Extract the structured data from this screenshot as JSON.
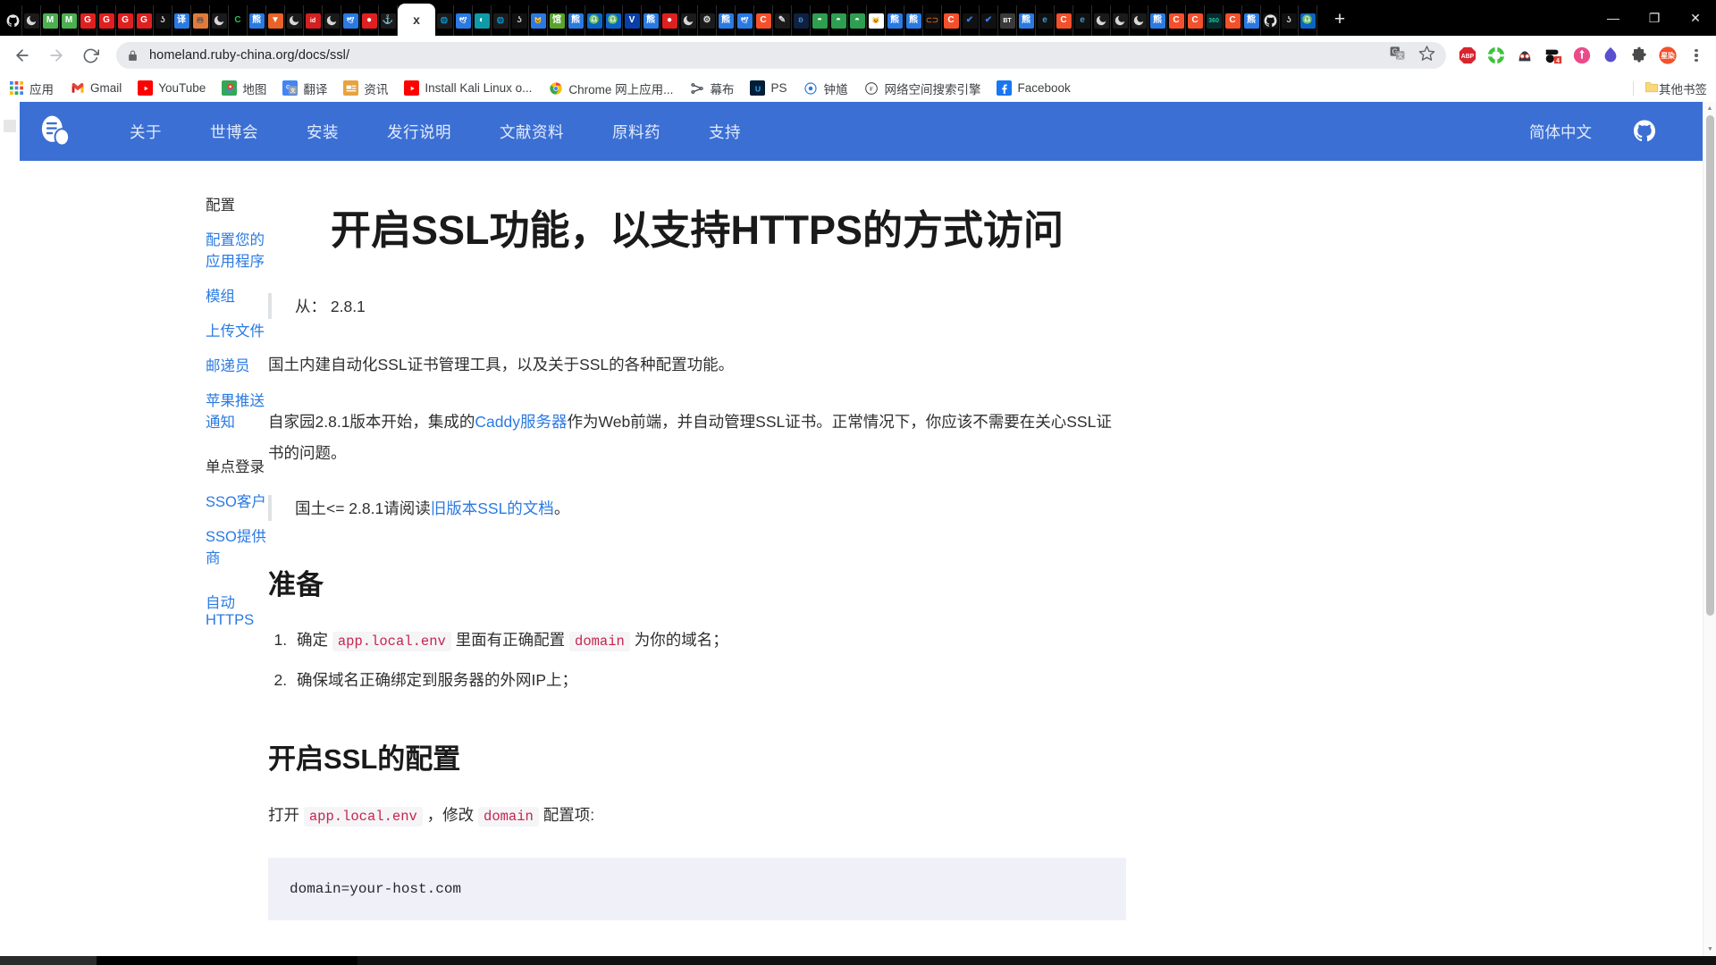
{
  "window": {
    "minimize": "—",
    "maximize": "❐",
    "close": "✕",
    "new_tab": "+"
  },
  "tabs": {
    "active_label": "x",
    "items": [
      {
        "name": "github-tab",
        "glyph": "",
        "bg": "#000000",
        "fg": "#ffffff",
        "kind": "github"
      },
      {
        "name": "dark-tab",
        "glyph": "",
        "bg": "#1b1b1b",
        "fg": "#ffffff",
        "kind": "moon"
      },
      {
        "name": "m-green-tab-1",
        "glyph": "M",
        "bg": "#4caf50",
        "fg": "#ffffff"
      },
      {
        "name": "m-green-tab-2",
        "glyph": "M",
        "bg": "#4caf50",
        "fg": "#ffffff"
      },
      {
        "name": "g-red-tab-1",
        "glyph": "G",
        "bg": "#e02020",
        "fg": "#ffffff"
      },
      {
        "name": "g-red-tab-2",
        "glyph": "G",
        "bg": "#e02020",
        "fg": "#ffffff"
      },
      {
        "name": "g-red-tab-3",
        "glyph": "G",
        "bg": "#e02020",
        "fg": "#ffffff"
      },
      {
        "name": "g-red-tab-4",
        "glyph": "G",
        "bg": "#e02020",
        "fg": "#ffffff"
      },
      {
        "name": "script-tab",
        "glyph": "ʖ",
        "bg": "#111111",
        "fg": "#c8c8c8"
      },
      {
        "name": "translate-tab",
        "glyph": "译",
        "bg": "#2a7ae2",
        "fg": "#ffffff"
      },
      {
        "name": "bear-tab",
        "glyph": "🐻",
        "bg": "#e07b39",
        "fg": "#ffffff"
      },
      {
        "name": "moon2-tab",
        "glyph": "",
        "bg": "#1b1b1b",
        "fg": "#dddddd",
        "kind": "moon"
      },
      {
        "name": "c-green-tab",
        "glyph": "C",
        "bg": "#000000",
        "fg": "#22c55e"
      },
      {
        "name": "baidu-tab-1",
        "glyph": "熊",
        "bg": "#2a7ae2",
        "fg": "#ffffff"
      },
      {
        "name": "orange-flag-tab",
        "glyph": "▼",
        "bg": "#e8622a",
        "fg": "#ffffff"
      },
      {
        "name": "moon3-tab",
        "glyph": "",
        "bg": "#1b1b1b",
        "fg": "#dddddd",
        "kind": "moon"
      },
      {
        "name": "id-red-tab",
        "glyph": "id",
        "bg": "#d32020",
        "fg": "#ffffff"
      },
      {
        "name": "moon4-tab",
        "glyph": "",
        "bg": "#1b1b1b",
        "fg": "#dddddd",
        "kind": "moon"
      },
      {
        "name": "blue-bird-tab",
        "glyph": "🕊",
        "bg": "#2a7ae2",
        "fg": "#ffffff"
      },
      {
        "name": "red-bean-tab",
        "glyph": "●",
        "bg": "#e02020",
        "fg": "#ffffff"
      },
      {
        "name": "anchor-tab",
        "glyph": "⚓",
        "bg": "#1b1b1b",
        "fg": "#b9c4ce"
      },
      {
        "name": "active-tab",
        "glyph": "x",
        "bg": "#ffffff",
        "fg": "#333333",
        "active": true
      },
      {
        "name": "globe-tab-1",
        "glyph": "🌐",
        "bg": "#1b1b1b",
        "fg": "#b9c4ce"
      },
      {
        "name": "blue-bird-tab-2",
        "glyph": "🕊",
        "bg": "#2a7ae2",
        "fg": "#ffffff"
      },
      {
        "name": "teal-circle-tab",
        "glyph": "◐",
        "bg": "#0f9aa8",
        "fg": "#ffffff"
      },
      {
        "name": "globe-tab-2",
        "glyph": "🌐",
        "bg": "#1b1b1b",
        "fg": "#b9c4ce"
      },
      {
        "name": "script-tab-2",
        "glyph": "ʖ",
        "bg": "#111111",
        "fg": "#c8c8c8"
      },
      {
        "name": "doraemon-tab",
        "glyph": "😺",
        "bg": "#2a7ae2",
        "fg": "#ffffff"
      },
      {
        "name": "guan-green-tab",
        "glyph": "馆",
        "bg": "#5aa32e",
        "fg": "#ffffff"
      },
      {
        "name": "baidu-tab-2",
        "glyph": "熊",
        "bg": "#2a7ae2",
        "fg": "#ffffff"
      },
      {
        "name": "libra-tab-1",
        "glyph": "♎",
        "bg": "#0b64c8",
        "fg": "#ffffff"
      },
      {
        "name": "libra-tab-2",
        "glyph": "♎",
        "bg": "#0b64c8",
        "fg": "#ffffff"
      },
      {
        "name": "v-blue-tab",
        "glyph": "V",
        "bg": "#0b3fa8",
        "fg": "#ffffff"
      },
      {
        "name": "baidu-tab-3",
        "glyph": "熊",
        "bg": "#2a7ae2",
        "fg": "#ffffff"
      },
      {
        "name": "red-bean-tab-2",
        "glyph": "●",
        "bg": "#e02020",
        "fg": "#ffffff"
      },
      {
        "name": "moon5-tab",
        "glyph": "",
        "bg": "#1b1b1b",
        "fg": "#dddddd",
        "kind": "moon"
      },
      {
        "name": "gear-tab",
        "glyph": "⚙",
        "bg": "#1b1b1b",
        "fg": "#e0e0e0"
      },
      {
        "name": "baidu-tab-4",
        "glyph": "熊",
        "bg": "#2a7ae2",
        "fg": "#ffffff"
      },
      {
        "name": "blue-bird-tab-3",
        "glyph": "🕊",
        "bg": "#2a7ae2",
        "fg": "#ffffff"
      },
      {
        "name": "c-orange-tab-1",
        "glyph": "C",
        "bg": "#f4502b",
        "fg": "#ffffff"
      },
      {
        "name": "pen-tab",
        "glyph": "✎",
        "bg": "#1b1b1b",
        "fg": "#dcdcdc"
      },
      {
        "name": "dna-tab",
        "glyph": "ʚ",
        "bg": "#0f2040",
        "fg": "#4a8fd4"
      },
      {
        "name": "green-dome-tab-1",
        "glyph": "◓",
        "bg": "#2e9e4f",
        "fg": "#ffffff"
      },
      {
        "name": "green-dome-tab-2",
        "glyph": "◓",
        "bg": "#2e9e4f",
        "fg": "#ffffff"
      },
      {
        "name": "green-dome-tab-3",
        "glyph": "◓",
        "bg": "#2e9e4f",
        "fg": "#ffffff"
      },
      {
        "name": "doraemon-tab-2",
        "glyph": "😺",
        "bg": "#ffffff",
        "fg": "#2a7ae2"
      },
      {
        "name": "baidu-tab-5",
        "glyph": "熊",
        "bg": "#2a7ae2",
        "fg": "#ffffff"
      },
      {
        "name": "baidu-tab-6",
        "glyph": "熊",
        "bg": "#2a7ae2",
        "fg": "#ffffff"
      },
      {
        "name": "orange-bracket-tab",
        "glyph": "⊂⊃",
        "bg": "#111111",
        "fg": "#f07020"
      },
      {
        "name": "c-orange-tab-2",
        "glyph": "C",
        "bg": "#f4502b",
        "fg": "#ffffff"
      },
      {
        "name": "v-check-tab-1",
        "glyph": "✔",
        "bg": "#111111",
        "fg": "#2f80ed"
      },
      {
        "name": "v-check-tab-2",
        "glyph": "✔",
        "bg": "#111111",
        "fg": "#2f80ed"
      },
      {
        "name": "bt-tab",
        "glyph": "BT",
        "bg": "#3a3a3a",
        "fg": "#ffffff"
      },
      {
        "name": "baidu-tab-7",
        "glyph": "熊",
        "bg": "#2a7ae2",
        "fg": "#ffffff"
      },
      {
        "name": "edge-tab-1",
        "glyph": "e",
        "bg": "#111111",
        "fg": "#2f9fe0"
      },
      {
        "name": "c-orange-tab-3",
        "glyph": "C",
        "bg": "#f4502b",
        "fg": "#ffffff"
      },
      {
        "name": "edge-tab-2",
        "glyph": "e",
        "bg": "#111111",
        "fg": "#2f9fe0"
      },
      {
        "name": "moon6-tab",
        "glyph": "",
        "bg": "#1b1b1b",
        "fg": "#dddddd",
        "kind": "moon"
      },
      {
        "name": "moon7-tab",
        "glyph": "",
        "bg": "#1b1b1b",
        "fg": "#dddddd",
        "kind": "moon"
      },
      {
        "name": "moon8-tab",
        "glyph": "",
        "bg": "#1b1b1b",
        "fg": "#dddddd",
        "kind": "moon"
      },
      {
        "name": "baidu-tab-8",
        "glyph": "熊",
        "bg": "#2a7ae2",
        "fg": "#ffffff"
      },
      {
        "name": "c-orange-tab-4",
        "glyph": "C",
        "bg": "#f4502b",
        "fg": "#ffffff"
      },
      {
        "name": "c-orange-tab-5",
        "glyph": "C",
        "bg": "#f4502b",
        "fg": "#ffffff"
      },
      {
        "name": "safe360-tab",
        "glyph": "360",
        "bg": "#0b2b2b",
        "fg": "#1fc4a8"
      },
      {
        "name": "c-orange-tab-6",
        "glyph": "C",
        "bg": "#f4502b",
        "fg": "#ffffff"
      },
      {
        "name": "baidu-tab-9",
        "glyph": "熊",
        "bg": "#2a7ae2",
        "fg": "#ffffff"
      },
      {
        "name": "github-tab-2",
        "glyph": "",
        "bg": "#111111",
        "fg": "#dddddd",
        "kind": "github"
      },
      {
        "name": "script-tab-3",
        "glyph": "ʖ",
        "bg": "#111111",
        "fg": "#c8c8c8"
      },
      {
        "name": "libra-tab-3",
        "glyph": "♎",
        "bg": "#0b64c8",
        "fg": "#ffffff"
      }
    ]
  },
  "toolbar": {
    "back": "←",
    "forward": "→",
    "reload": "⟳",
    "url": "homeland.ruby-china.org/docs/ssl/",
    "lock_icon": "lock-icon",
    "translate_icon": "translate-icon",
    "bookmark_star": "☆",
    "extensions": [
      {
        "name": "adblock-plus-extension",
        "label": "ABP",
        "bg": "#d9232e",
        "fg": "#ffffff"
      },
      {
        "name": "tampermonkey-extension",
        "label": "🧩",
        "bg": "#3ec13e",
        "fg": "#ffffff"
      },
      {
        "name": "dark-reader-extension",
        "label": "👓",
        "bg": "#2b3a4a",
        "fg": "#ffffff"
      },
      {
        "name": "downloads-extension",
        "label": "4",
        "bg": "#2b2b2b",
        "fg": "#ffffff",
        "badge": "4",
        "badge_color": "#e03b2f"
      },
      {
        "name": "pink-tool-extension",
        "label": "T",
        "bg": "#ec4b89",
        "fg": "#ffffff"
      },
      {
        "name": "simplenote-extension",
        "label": "❀",
        "bg": "#5a4fcf",
        "fg": "#ffffff"
      },
      {
        "name": "puzzle-extensions-menu",
        "label": "🧩",
        "bg": "#ffffff",
        "fg": "#5f6368"
      },
      {
        "name": "xingran-extension",
        "label": "星染",
        "bg": "#f4502b",
        "fg": "#ffffff"
      }
    ],
    "menu": "chrome-menu-icon"
  },
  "bookmarks": {
    "items": [
      {
        "name": "bookmark-apps",
        "label": "应用",
        "icon": "apps-grid-icon",
        "bg": "transparent",
        "fg": "#4285f4",
        "glyph": "⠿"
      },
      {
        "name": "bookmark-gmail",
        "label": "Gmail",
        "icon": "gmail-icon",
        "bg": "transparent",
        "fg": "#ea4335",
        "glyph": "G"
      },
      {
        "name": "bookmark-youtube",
        "label": "YouTube",
        "icon": "youtube-icon",
        "bg": "#ff0000",
        "fg": "#ffffff",
        "glyph": "▶"
      },
      {
        "name": "bookmark-maps",
        "label": "地图",
        "icon": "maps-pin-icon",
        "bg": "#34a853",
        "fg": "#ffffff",
        "glyph": "📍"
      },
      {
        "name": "bookmark-translate",
        "label": "翻译",
        "icon": "translate-icon",
        "bg": "#4285f4",
        "fg": "#ffffff",
        "glyph": "文"
      },
      {
        "name": "bookmark-news",
        "label": "资讯",
        "icon": "news-icon",
        "bg": "#e8a33d",
        "fg": "#ffffff",
        "glyph": "📰"
      },
      {
        "name": "bookmark-install-kali",
        "label": "Install Kali Linux o...",
        "icon": "youtube-icon",
        "bg": "#ff0000",
        "fg": "#ffffff",
        "glyph": "▶"
      },
      {
        "name": "bookmark-chrome-webstore",
        "label": "Chrome 网上应用...",
        "icon": "chrome-icon",
        "bg": "transparent",
        "fg": "#4285f4",
        "glyph": "◉"
      },
      {
        "name": "bookmark-mubu",
        "label": "幕布",
        "icon": "mubu-icon",
        "bg": "transparent",
        "fg": "#2f3640",
        "glyph": "⋈"
      },
      {
        "name": "bookmark-ps",
        "label": "PS",
        "icon": "photoshop-icon",
        "bg": "#001e36",
        "fg": "#31a8ff",
        "glyph": "U"
      },
      {
        "name": "bookmark-zhongkui",
        "label": "钟馗",
        "icon": "zhongkui-icon",
        "bg": "transparent",
        "fg": "#2a7ae2",
        "glyph": "◎"
      },
      {
        "name": "bookmark-cyberspace-search",
        "label": "网络空间搜索引擎",
        "icon": "fofa-icon",
        "bg": "transparent",
        "fg": "#444444",
        "glyph": "Ⓕ"
      },
      {
        "name": "bookmark-facebook",
        "label": "Facebook",
        "icon": "facebook-icon",
        "bg": "#1877f2",
        "fg": "#ffffff",
        "glyph": "f"
      }
    ],
    "other_bookmarks": {
      "label": "其他书签",
      "icon": "folder-icon"
    }
  },
  "site": {
    "brand_icon": "homeland-logo-icon",
    "nav": [
      {
        "name": "nav-about",
        "label": "关于"
      },
      {
        "name": "nav-expo",
        "label": "世博会"
      },
      {
        "name": "nav-install",
        "label": "安装"
      },
      {
        "name": "nav-release-notes",
        "label": "发行说明"
      },
      {
        "name": "nav-documentation",
        "label": "文献资料"
      },
      {
        "name": "nav-api",
        "label": "原料药"
      },
      {
        "name": "nav-support",
        "label": "支持"
      }
    ],
    "language": "简体中文",
    "github_icon": "github-icon",
    "nav_bg": "#3b6fd4"
  },
  "sidebar": {
    "groups": [
      {
        "name": "sidebar-group-configuration",
        "title": "配置",
        "links": [
          {
            "name": "sidebar-link-configure-your-app",
            "label": "配置您的应用程序"
          },
          {
            "name": "sidebar-link-modules",
            "label": "模组"
          },
          {
            "name": "sidebar-link-upload-files",
            "label": "上传文件"
          },
          {
            "name": "sidebar-link-mailman",
            "label": "邮递员"
          },
          {
            "name": "sidebar-link-apple-push",
            "label": "苹果推送通知"
          }
        ]
      },
      {
        "name": "sidebar-group-sso",
        "title": "单点登录",
        "links": [
          {
            "name": "sidebar-link-sso-client",
            "label": "SSO客户"
          },
          {
            "name": "sidebar-link-sso-provider",
            "label": "SSO提供商"
          }
        ]
      },
      {
        "name": "sidebar-group-auto-https",
        "title": "",
        "links": [
          {
            "name": "sidebar-link-auto-https",
            "label": "自动HTTPS"
          }
        ]
      }
    ]
  },
  "article": {
    "title": "开启SSL功能，以支持HTTPS的方式访问",
    "note_version": "从： 2.8.1",
    "paragraph_1": "国土内建自动化SSL证书管理工具，以及关于SSL的各种配置功能。",
    "paragraph_2_a": "自家园2.8.1版本开始，集成的",
    "paragraph_2_link": "Caddy服务器",
    "paragraph_2_b": "作为Web前端，并自动管理SSL证书。正常情况下，你应该不需要在关心SSL证书的问题。",
    "note_2_a": "国土<= 2.8.1请阅读",
    "note_2_link": "旧版本SSL的文档",
    "note_2_b": "。",
    "section_prepare": "准备",
    "steps": [
      {
        "name": "step-item-1",
        "text_a": "确定 ",
        "code_1": "app.local.env",
        "text_b": " 里面有正确配置 ",
        "code_2": "domain",
        "text_c": " 为你的域名；"
      },
      {
        "name": "step-item-2",
        "text_a": "确保域名正确绑定到服务器的外网IP上；",
        "code_1": "",
        "text_b": "",
        "code_2": "",
        "text_c": ""
      }
    ],
    "section_enable_ssl": "开启SSL的配置",
    "paragraph_3_a": "打开 ",
    "paragraph_3_code_1": "app.local.env",
    "paragraph_3_b": " ，修改 ",
    "paragraph_3_code_2": "domain",
    "paragraph_3_c": " 配置项:",
    "code_block": "domain=your-host.com"
  },
  "scrollbar": {
    "up_arrow": "▲",
    "down_arrow": "▼"
  }
}
